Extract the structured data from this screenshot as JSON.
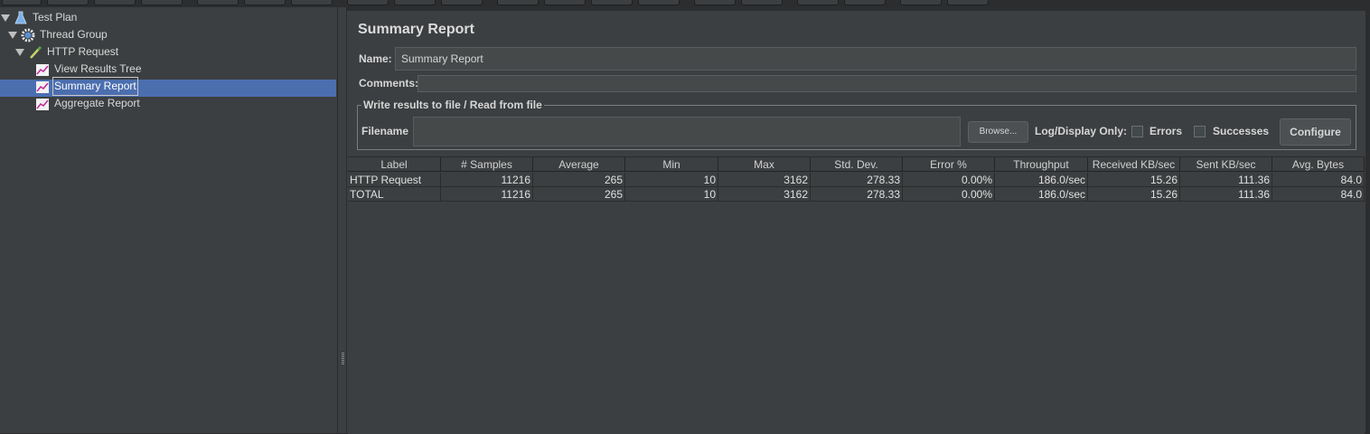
{
  "tree": {
    "items": [
      {
        "label": "Test Plan",
        "icon": "flask-icon"
      },
      {
        "label": "Thread Group",
        "icon": "gear-icon"
      },
      {
        "label": "HTTP Request",
        "icon": "pipette-icon"
      },
      {
        "label": "View Results Tree",
        "icon": "graph-icon"
      },
      {
        "label": "Summary Report",
        "icon": "graph-icon"
      },
      {
        "label": "Aggregate Report",
        "icon": "graph-icon"
      }
    ],
    "selected": "Summary Report"
  },
  "panel": {
    "title": "Summary Report",
    "name_label": "Name:",
    "name_value": "Summary Report",
    "comments_label": "Comments:",
    "group_title": "Write results to file / Read from file",
    "filename_label": "Filename",
    "browse_label": "Browse...",
    "log_display_label": "Log/Display Only:",
    "errors_label": "Errors",
    "successes_label": "Successes",
    "configure_label": "Configure"
  },
  "table": {
    "columns": [
      "Label",
      "# Samples",
      "Average",
      "Min",
      "Max",
      "Std. Dev.",
      "Error %",
      "Throughput",
      "Received KB/sec",
      "Sent KB/sec",
      "Avg. Bytes"
    ],
    "rows": [
      [
        "HTTP Request",
        "11216",
        "265",
        "10",
        "3162",
        "278.33",
        "0.00%",
        "186.0/sec",
        "15.26",
        "111.36",
        "84.0"
      ],
      [
        "TOTAL",
        "11216",
        "265",
        "10",
        "3162",
        "278.33",
        "0.00%",
        "186.0/sec",
        "15.26",
        "111.36",
        "84.0"
      ]
    ]
  },
  "colors": {
    "background": "#3c3f41",
    "selection": "#4b6eaf"
  }
}
